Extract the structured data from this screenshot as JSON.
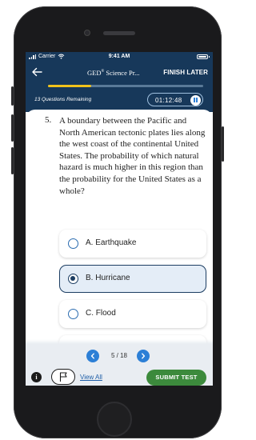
{
  "status_bar": {
    "carrier": "Carrier",
    "time": "9:41 AM"
  },
  "nav": {
    "title": "GED",
    "title_mark": "®",
    "title_rest": " Science Pr...",
    "finish_later_label": "FINISH LATER"
  },
  "progress": {
    "fraction_complete": 0.28
  },
  "session": {
    "remaining_text": "13 Questions Remaining",
    "timer": "01:12:48"
  },
  "question": {
    "number": "5.",
    "text": "A boundary between the Pacific and North American tectonic plates lies along the west coast of the continental United States. The probability of which natural hazard is much higher in this region than the probability for the United States as a whole?"
  },
  "options": [
    {
      "label": "A. Earthquake",
      "selected": false
    },
    {
      "label": "B. Hurricane",
      "selected": true
    },
    {
      "label": "C. Flood",
      "selected": false
    }
  ],
  "pager": {
    "text": "5 / 18"
  },
  "footer": {
    "info_label": "i",
    "view_all_label": "View All",
    "submit_label": "SUBMIT TEST"
  },
  "colors": {
    "header_bg": "#17385a",
    "accent_blue": "#2c7fd6",
    "progress_yellow": "#f1c21b",
    "submit_green": "#3c8a3c",
    "selected_bg": "#e4edf7"
  }
}
